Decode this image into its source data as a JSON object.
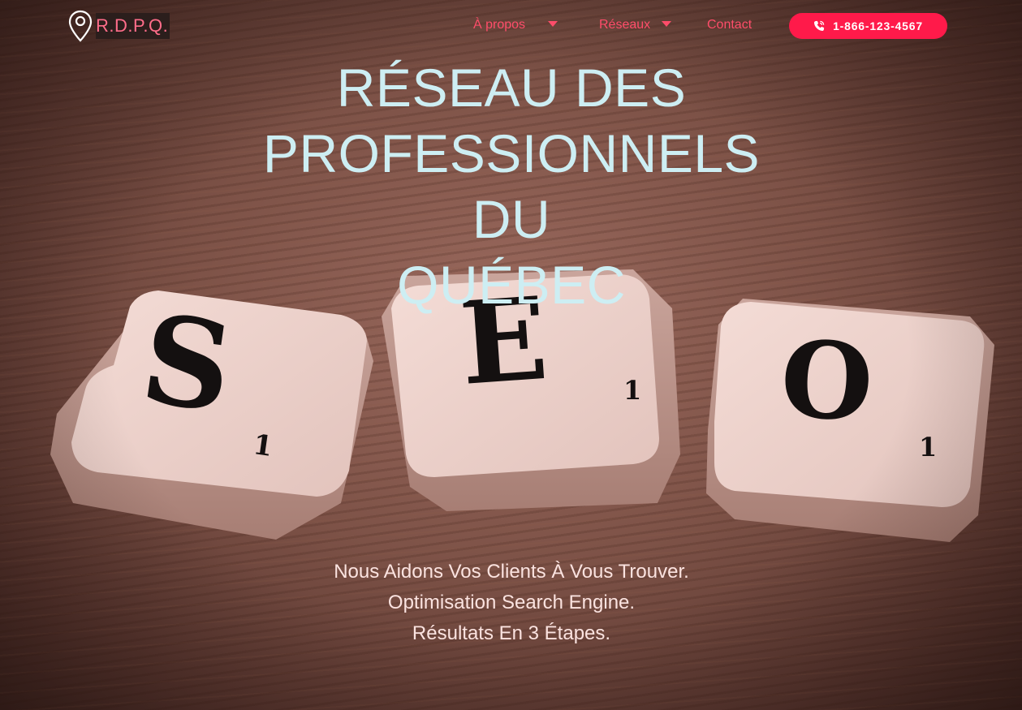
{
  "brand": {
    "name": "R.D.P.Q."
  },
  "nav": {
    "about_label": "À propos",
    "networks_label": "Réseaux",
    "contact_label": "Contact",
    "phone_label": "1-866-123-4567"
  },
  "hero": {
    "title_line1": "RÉSEAU DES",
    "title_line2": "PROFESSIONNELS DU",
    "title_line3": "QUÉBEC",
    "tiles": {
      "tile1_letter": "S",
      "tile1_sub": "1",
      "tile2_letter": "E",
      "tile2_sub": "1",
      "tile3_letter": "O",
      "tile3_sub": "1"
    },
    "tagline_line1": "Nous Aidons Vos Clients À Vous Trouver.",
    "tagline_line2": "Optimisation Search Engine.",
    "tagline_line3": "Résultats En 3 Étapes."
  },
  "colors": {
    "accent": "#ff1a4a",
    "nav_link": "#ff4d6a",
    "title": "#cdeef3",
    "tagline": "#fbe3e0"
  },
  "icons": {
    "brand": "map-pin-icon",
    "phone": "phone-icon",
    "dropdown": "caret-down-icon"
  }
}
